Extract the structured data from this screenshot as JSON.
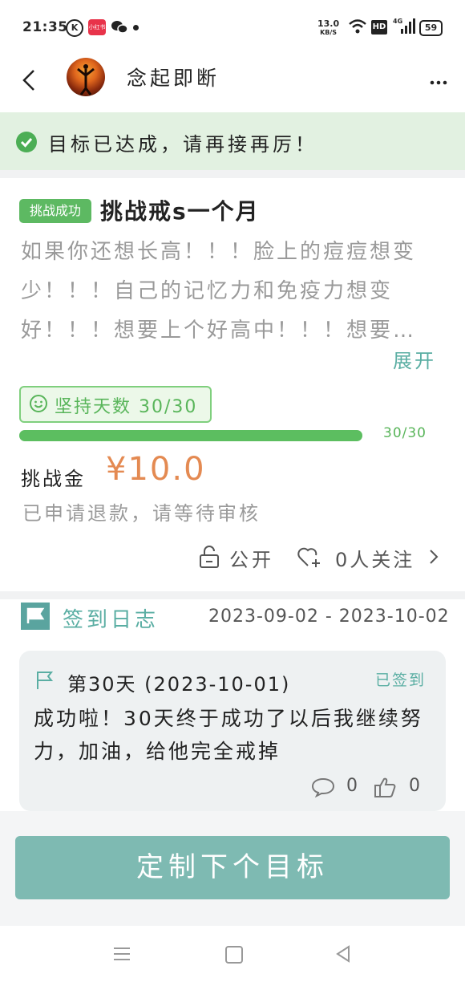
{
  "status_bar": {
    "time": "21:35",
    "k_badge": "K",
    "red_app": "小红书",
    "net_speed_value": "13.0",
    "net_speed_unit": "KB/S",
    "hd": "HD",
    "network": "4G",
    "battery": "59"
  },
  "header": {
    "title": "念起即断",
    "back_icon": "chevron-left-icon",
    "more_icon": "more-dots-icon"
  },
  "banner": {
    "text": "目标已达成，请再接再厉！",
    "icon": "check-circle-icon",
    "color": "#4cae55"
  },
  "challenge": {
    "badge": "挑战成功",
    "title": "挑战戒s一个月",
    "description_lines": [
      "如果你还想长高！！！脸上的痘痘想变",
      "少！！！自己的记忆力和免疫力想变",
      "好！！！想要上个好高中！！！想要…"
    ],
    "expand": "展开",
    "days_text": "坚持天数 30/30",
    "progress": {
      "current": 30,
      "total": 30,
      "label": "30/30",
      "fraction": 1.0
    },
    "fee_label": "挑战金",
    "fee_value": "¥10.0",
    "refund_status": "已申请退款，请等待审核",
    "visibility": "公开",
    "followers": "0人关注"
  },
  "log": {
    "title": "签到日志",
    "date_range": "2023-09-02 - 2023-10-02",
    "entry": {
      "title": "第30天 (2023-10-01)",
      "status": "已签到",
      "content": "成功啦！30天终于成功了以后我继续努力，加油，给他完全戒掉",
      "comments": "0",
      "likes": "0"
    }
  },
  "cta": {
    "label": "定制下个目标"
  },
  "colors": {
    "accent": "#5aaea3",
    "success": "#5cbe60",
    "fee": "#e48a52",
    "cta": "#7ebab2"
  }
}
